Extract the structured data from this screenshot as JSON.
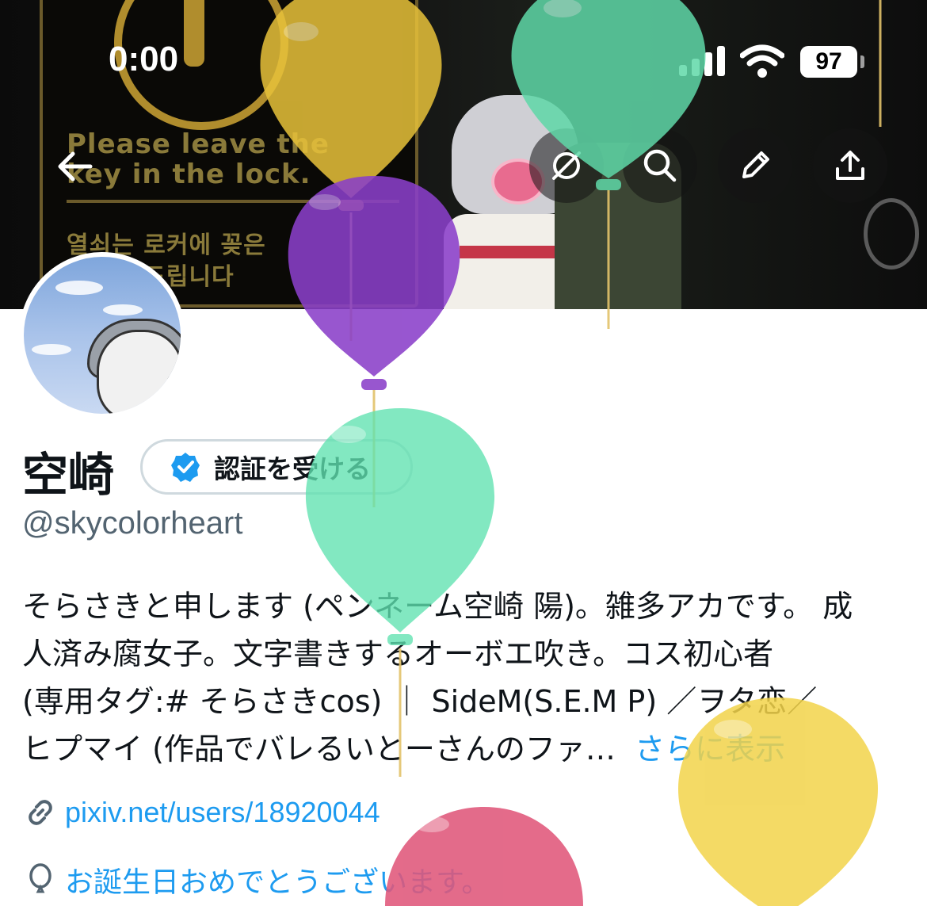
{
  "status_bar": {
    "time": "0:00",
    "battery": "97",
    "signal_icon": "cellular-signal-icon",
    "wifi_icon": "wifi-icon"
  },
  "banner": {
    "sign_line_1": "Please leave the",
    "sign_line_2": "key in the lock.",
    "sign_line_3": "열쇠는 로커에 꽂은",
    "sign_line_4": "채 부탁드립니다"
  },
  "nav": {
    "back_icon": "arrow-left-icon",
    "grok_icon": "grok-icon",
    "search_icon": "search-icon",
    "edit_icon": "pencil-icon",
    "share_icon": "share-icon"
  },
  "profile": {
    "display_name": "空崎",
    "verify_label": "認証を受ける",
    "handle": "@skycolorheart",
    "bio_lines": [
      "そらさきと申します (ペンネーム空崎 陽)。雑多アカです。 成",
      "人済み腐女子。文字書きするオーボエ吹き。コス初心者",
      "(専用タグ:# そらさきcos) ｜ SideM(S.E.M P) ／ヲタ恋／",
      "ヒプマイ (作品でバレるいとーさんのファ…"
    ],
    "show_more": "さらに表示",
    "link": "pixiv.net/users/18920044",
    "birthday_text": "お誕生日おめでとうございます。"
  },
  "colors": {
    "accent": "#1d9bf0",
    "secondary_text": "#536471",
    "balloon_yellow": "#e8c23a",
    "balloon_green": "#5fd8a8",
    "balloon_purple": "#8a3fc9",
    "balloon_pink": "#e0577a"
  }
}
